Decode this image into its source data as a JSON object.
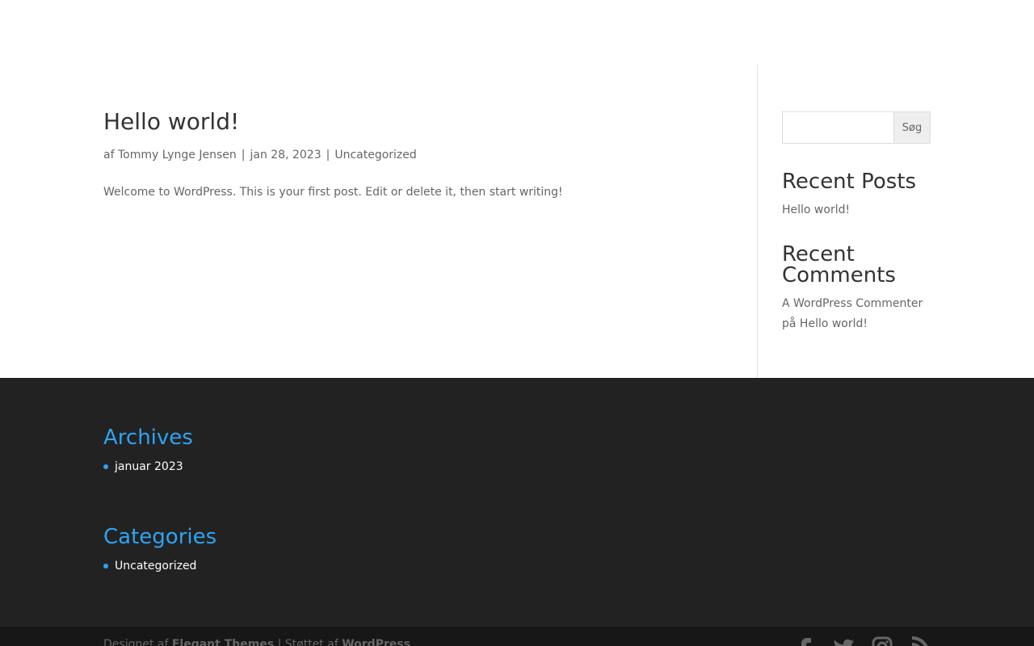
{
  "post": {
    "title": "Hello world!",
    "meta_prefix": "af",
    "author": "Tommy Lynge Jensen",
    "separator": "|",
    "date": "jan 28, 2023",
    "category": "Uncategorized",
    "excerpt": "Welcome to WordPress. This is your first post. Edit or delete it, then start writing!"
  },
  "sidebar": {
    "search": {
      "value": "",
      "button_label": "Søg"
    },
    "recent_posts": {
      "title": "Recent Posts",
      "items": [
        "Hello world!"
      ]
    },
    "recent_comments": {
      "title_line1": "Recent",
      "title_line2": "Comments",
      "author": "A WordPress Commenter",
      "connector": "på",
      "post": "Hello world!"
    }
  },
  "footer": {
    "archives": {
      "title": "Archives",
      "items": [
        "januar 2023"
      ]
    },
    "categories": {
      "title": "Categories",
      "items": [
        "Uncategorized"
      ]
    },
    "credits": {
      "part1": "Designet af ",
      "theme": "Elegant Themes",
      "part2": " | Støttet af ",
      "platform": "WordPress"
    },
    "social_icons": [
      "facebook-icon",
      "twitter-icon",
      "instagram-icon",
      "rss-icon"
    ]
  },
  "colors": {
    "accent": "#2ea3f2",
    "footer_bg": "#222222",
    "bottom_bar_bg": "#171717",
    "heading": "#333333",
    "body_text": "#666666"
  }
}
